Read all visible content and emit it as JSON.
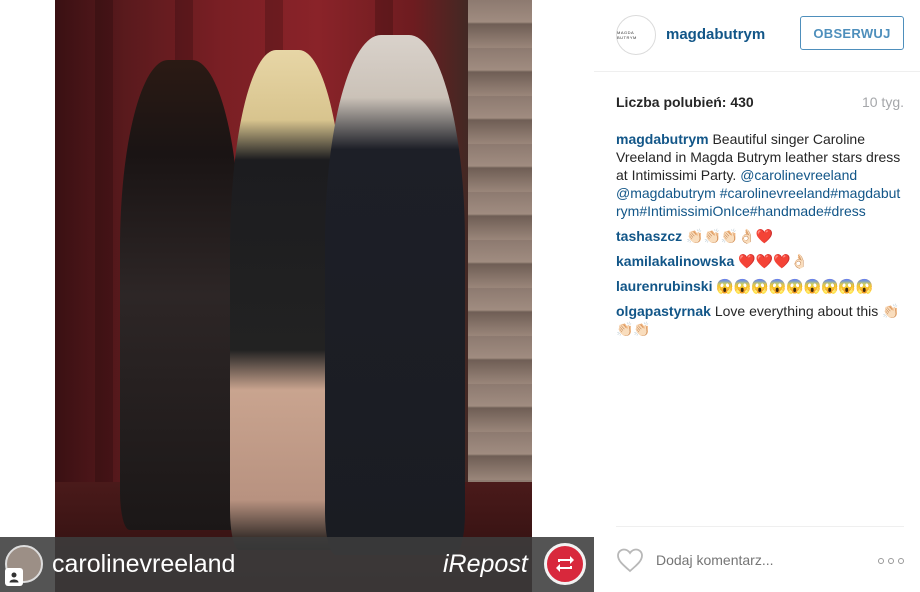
{
  "photo": {
    "repost_username": "carolinevreeland",
    "repost_brand": "iRepost"
  },
  "header": {
    "avatar_text": "MAGDA BUTRYM",
    "username": "magdabutrym",
    "follow_label": "OBSERWUJ"
  },
  "stats": {
    "likes": "Liczba polubień: 430",
    "age": "10 tyg."
  },
  "caption": {
    "user": "magdabutrym",
    "text": "Beautiful singer Caroline Vreeland in Magda Butrym leather stars dress at Intimissimi Party.",
    "mentions": "@carolinevreeland @magdabutrym",
    "hashtags": "#carolinevreeland#magdabutrym#IntimissimiOnIce#handmade#dress"
  },
  "comments": [
    {
      "user": "tashaszcz",
      "text": "👏🏻👏🏻👏🏻👌🏻❤️"
    },
    {
      "user": "kamilakalinowska",
      "text": "❤️❤️❤️👌🏻"
    },
    {
      "user": "laurenrubinski",
      "text": "😱😱😱😱😱😱😱😱😱"
    },
    {
      "user": "olgapastyrnak",
      "text": "Love everything about this 👏🏻👏🏻👏🏻"
    }
  ],
  "footer": {
    "comment_placeholder": "Dodaj komentarz..."
  },
  "colors": {
    "link": "#125688",
    "follow_border": "#4e8fbc",
    "muted": "#a5a7aa",
    "repost_red": "#d8283c"
  }
}
